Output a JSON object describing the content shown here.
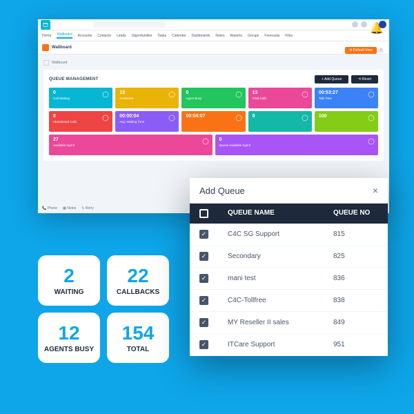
{
  "nav": {
    "items": [
      "Home",
      "Wallboard",
      "Accounts",
      "Contacts",
      "Leads",
      "Opportunities",
      "Tasks",
      "Calendar",
      "Dashboards",
      "Notes",
      "Reports",
      "Groups",
      "Forecasts",
      "Files"
    ],
    "active": "Wallboard"
  },
  "sub_title": "Wallboard",
  "crumb": "Wallboard",
  "mgmt_title": "QUEUE MANAGEMENT",
  "btn_add": "+ Add Queue",
  "btn_reset": "⟲ Reset",
  "btn_default": "⚙ Default View",
  "tiles": [
    {
      "v": "0",
      "l": "Call Waiting",
      "c": "c-cy"
    },
    {
      "v": "13",
      "l": "Answered",
      "c": "c-yl"
    },
    {
      "v": "0",
      "l": "Agent Busy",
      "c": "c-gr"
    },
    {
      "v": "13",
      "l": "Total Calls",
      "c": "c-pk"
    },
    {
      "v": "00:53:27",
      "l": "Talk Time",
      "c": "c-bl"
    },
    {
      "v": "0",
      "l": "Abandoned Calls",
      "c": "c-rd"
    },
    {
      "v": "00:00:04",
      "l": "Avg. Waiting Time",
      "c": "c-pu"
    },
    {
      "v": "00:04:07",
      "l": "",
      "c": "c-or"
    },
    {
      "v": "0",
      "l": "",
      "c": "c-tl"
    },
    {
      "v": "100",
      "l": "",
      "c": "c-lm"
    },
    {
      "v": "27",
      "l": "Available Agent",
      "c": "c-pk"
    },
    {
      "v": "0",
      "l": "Queue Available Agent",
      "c": "c-dp"
    }
  ],
  "foot": {
    "a": "📞 Phone",
    "b": "▦ Notes",
    "c": "↻ Retry"
  },
  "stats": [
    {
      "num": "2",
      "lab": "WAITING"
    },
    {
      "num": "22",
      "lab": "CALLBACKS"
    },
    {
      "num": "12",
      "lab": "AGENTS BUSY"
    },
    {
      "num": "154",
      "lab": "TOTAL"
    }
  ],
  "modal": {
    "title": "Add Queue",
    "col1": "QUEUE NAME",
    "col2": "QUEUE NO",
    "rows": [
      {
        "name": "C4C SG Support",
        "no": "815"
      },
      {
        "name": "Secondary",
        "no": "825"
      },
      {
        "name": "mani test",
        "no": "836"
      },
      {
        "name": "C4C-Tollfree",
        "no": "838"
      },
      {
        "name": "MY Reseller II sales",
        "no": "849"
      },
      {
        "name": "ITCare Support",
        "no": "951"
      }
    ]
  }
}
